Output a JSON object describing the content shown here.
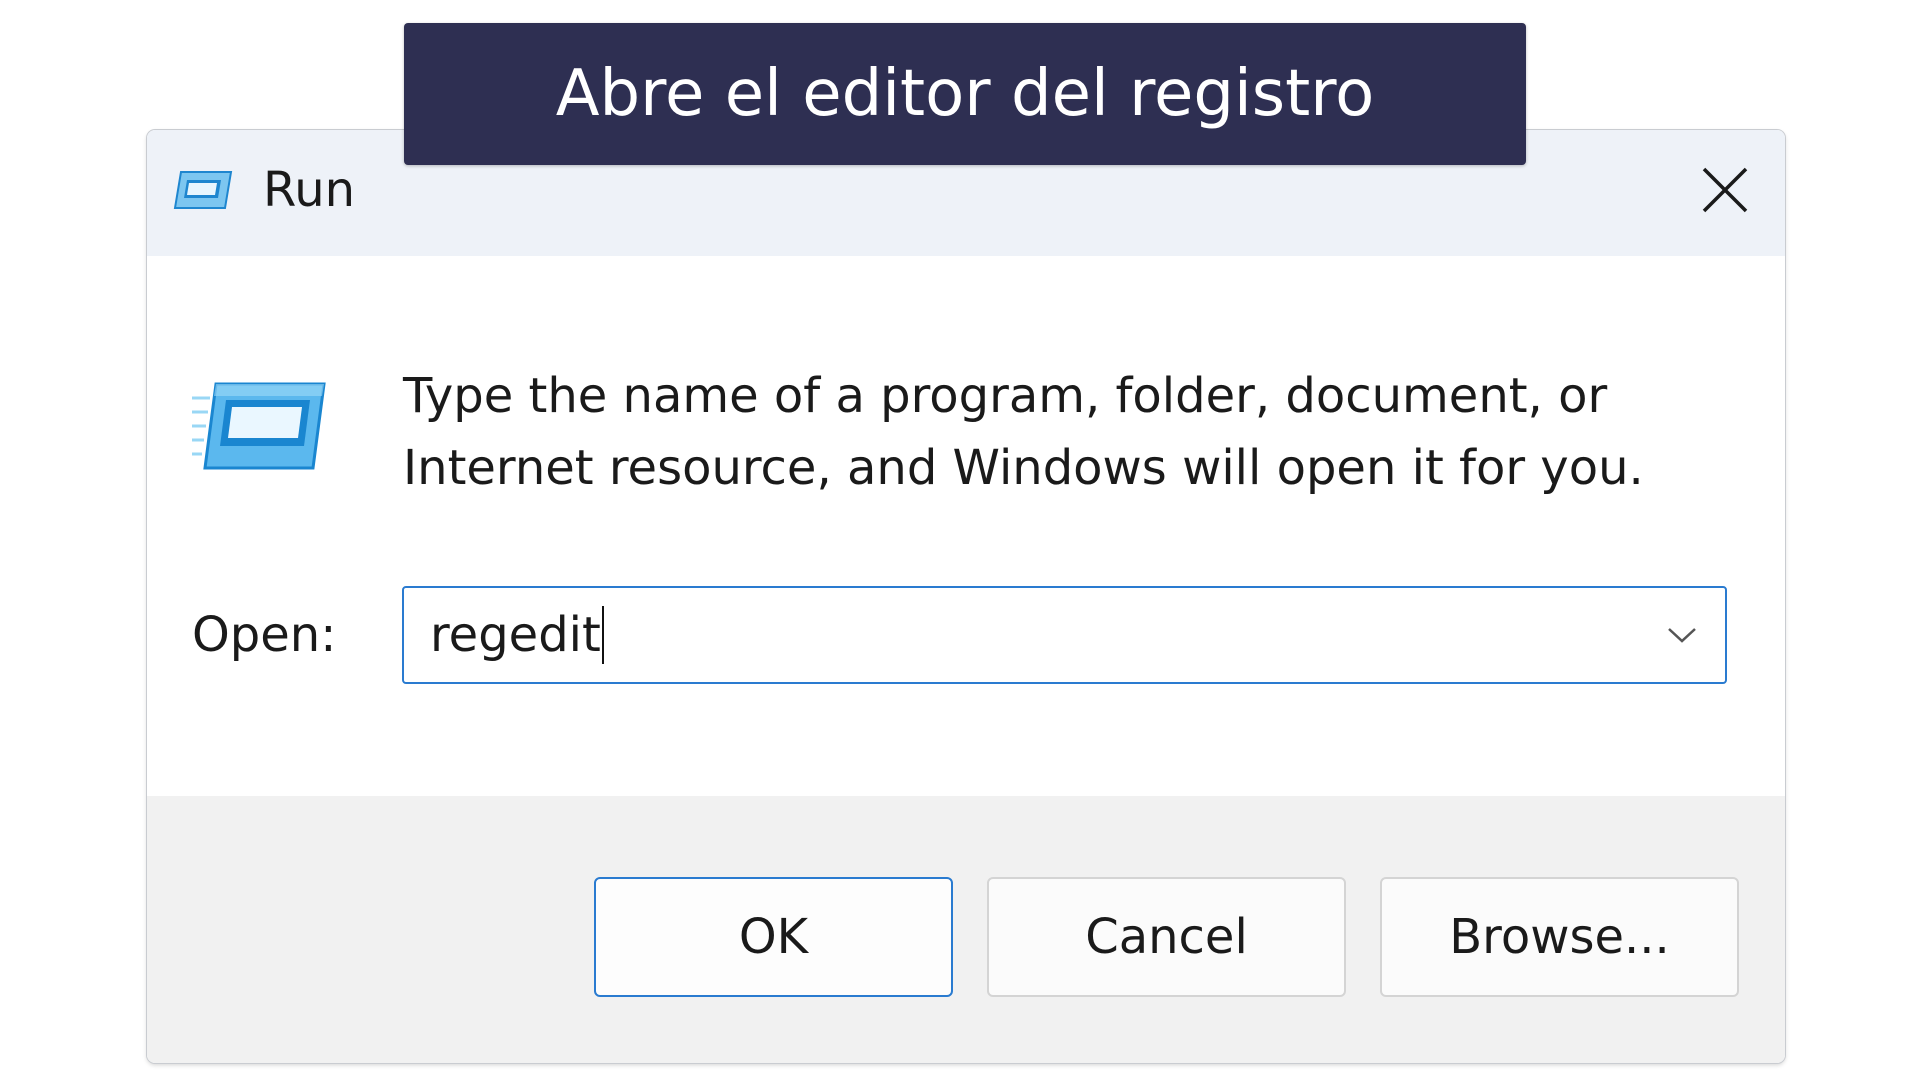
{
  "banner": {
    "text": "Abre el editor del registro"
  },
  "dialog": {
    "title": "Run",
    "app_icon": "run-icon",
    "close_icon": "close-icon",
    "description_line1": "Type the name of a program, folder, document, or",
    "description_line2": "Internet resource, and Windows will open it for you.",
    "open_label": "Open:",
    "open_value": "regedit",
    "dropdown_icon": "chevron-down-icon",
    "buttons": {
      "ok": "OK",
      "cancel": "Cancel",
      "browse": "Browse..."
    }
  },
  "colors": {
    "banner_bg": "#2e2f52",
    "accent": "#2a7bd0",
    "titlebar_bg": "#eef2f8",
    "footer_bg": "#f1f1f1"
  }
}
